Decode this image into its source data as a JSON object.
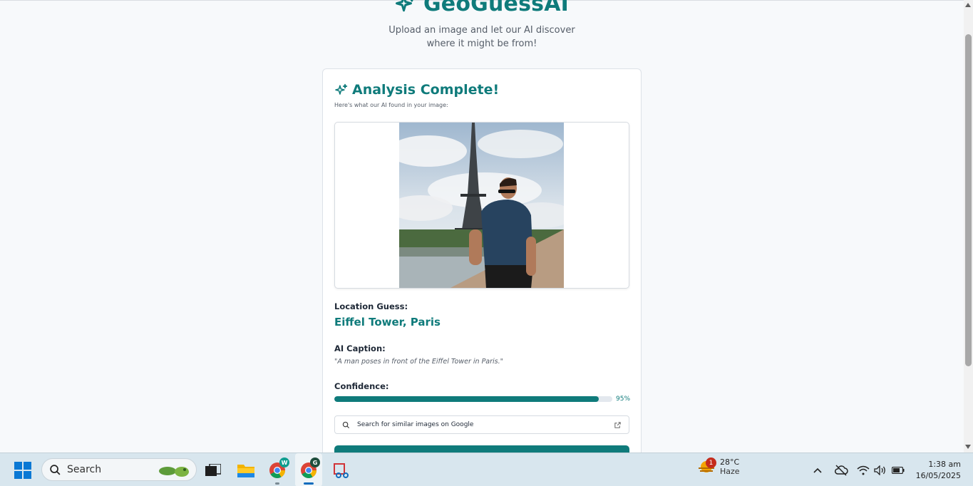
{
  "app": {
    "title": "GeoGuessAI",
    "subtitle": "Upload an image and let our AI discover where it might be from!"
  },
  "result": {
    "title": "Analysis Complete!",
    "subtitle": "Here's what our AI found in your image:",
    "location_label": "Location Guess:",
    "location_value": "Eiffel Tower, Paris",
    "caption_label": "AI Caption:",
    "caption_value": "\"A man poses in front of the Eiffel Tower in Paris.\"",
    "confidence_label": "Confidence:",
    "confidence_value": 95,
    "confidence_text": "95%",
    "search_button_label": "Search for similar images on Google"
  },
  "colors": {
    "accent": "#0f7b7b",
    "page_bg": "#f7f9fb",
    "taskbar_bg": "#d8e6ee"
  },
  "taskbar": {
    "search_placeholder": "Search",
    "apps": [
      {
        "name": "task-view",
        "icon": "task-view-icon"
      },
      {
        "name": "file-explorer",
        "icon": "folder-icon"
      },
      {
        "name": "chrome-profile-w",
        "icon": "chrome-icon",
        "badge": "W"
      },
      {
        "name": "chrome-profile-g",
        "icon": "chrome-icon",
        "badge": "G"
      },
      {
        "name": "snipping-tool",
        "icon": "snipping-tool-icon"
      }
    ],
    "weather": {
      "badge": "1",
      "temp": "28°C",
      "condition": "Haze"
    },
    "clock": {
      "time": "1:38 am",
      "date": "16/05/2025"
    }
  }
}
